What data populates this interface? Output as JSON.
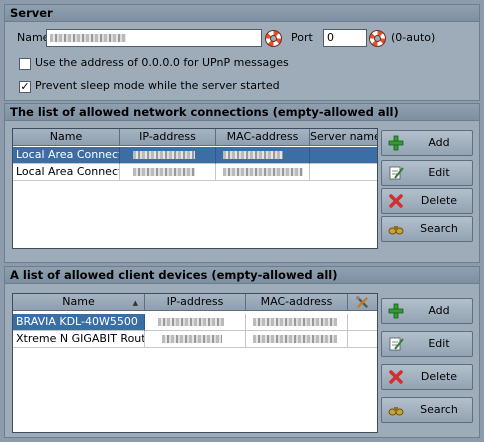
{
  "server": {
    "title": "Server",
    "name_label": "Name",
    "name_value": "",
    "port_label": "Port",
    "port_value": "0",
    "port_hint": "(0-auto)",
    "upnp_label": "Use the address of 0.0.0.0 for UPnP messages",
    "upnp_checked": false,
    "sleep_label": "Prevent sleep mode while the server started",
    "sleep_checked": true
  },
  "connections": {
    "title": "The list of allowed network connections (empty-allowed all)",
    "columns": [
      "Name",
      "IP-address",
      "MAC-address",
      "Server name"
    ],
    "rows": [
      {
        "name": "Local Area Connectio",
        "selected": true
      },
      {
        "name": "Local Area Connectio",
        "selected": false
      }
    ],
    "buttons": {
      "add": "Add",
      "edit": "Edit",
      "delete": "Delete",
      "search": "Search"
    }
  },
  "devices": {
    "title": "A list of allowed client devices (empty-allowed all)",
    "columns": [
      "Name",
      "IP-address",
      "MAC-address"
    ],
    "rows": [
      {
        "name": "BRAVIA KDL-40W5500",
        "selected": true
      },
      {
        "name": "Xtreme N GIGABIT Router",
        "selected": false
      }
    ],
    "buttons": {
      "add": "Add",
      "edit": "Edit",
      "delete": "Delete",
      "search": "Search"
    }
  },
  "icons": {
    "lifebuoy": "lifebuoy-icon",
    "add": "plus-icon",
    "edit": "pencil-note-icon",
    "delete": "red-x-icon",
    "search": "binoculars-icon",
    "tools": "tools-icon"
  },
  "colors": {
    "selection": "#3a6ea5",
    "panel": "#9eacba",
    "background": "#8c9cac"
  }
}
